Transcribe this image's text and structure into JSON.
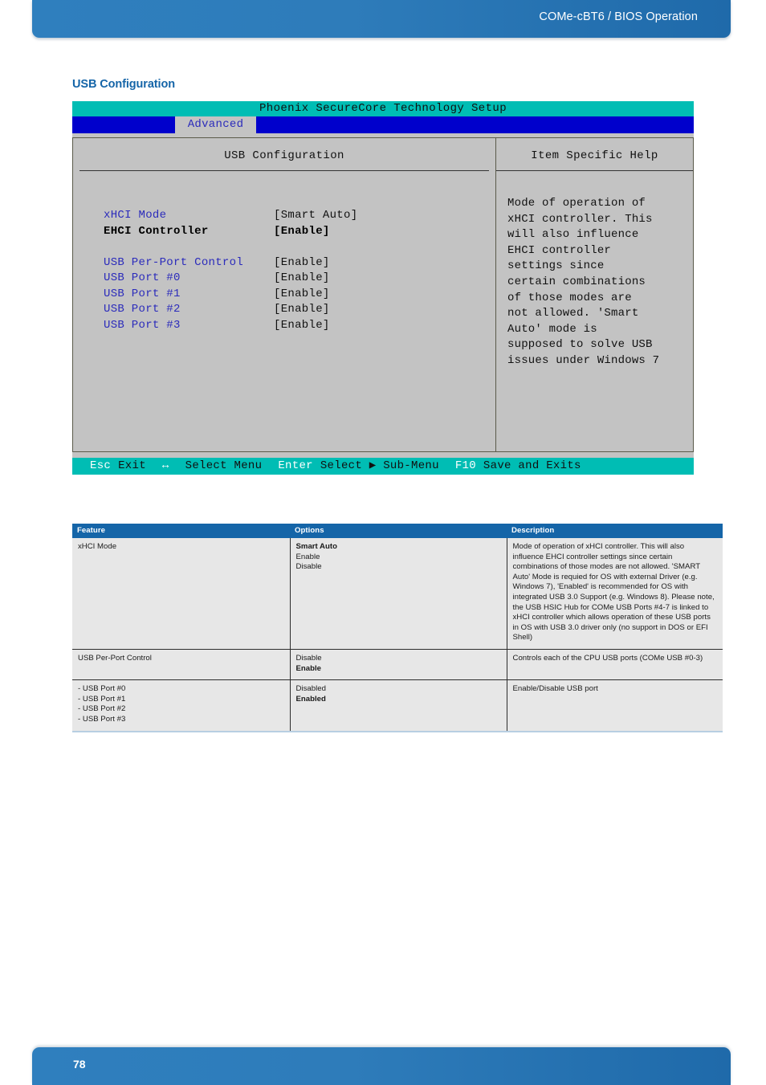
{
  "header": {
    "title": "COMe-cBT6 / BIOS Operation"
  },
  "section": {
    "heading": "USB Configuration"
  },
  "bios": {
    "title": "Phoenix SecureCore Technology Setup",
    "active_tab": "Advanced",
    "left_panel_title": "USB Configuration",
    "right_panel_title": "Item Specific Help",
    "settings": [
      {
        "label": "xHCI Mode",
        "value": "[Smart Auto]",
        "selected": false
      },
      {
        "label": "EHCI Controller",
        "value": "[Enable]",
        "selected": true
      },
      {
        "label": "",
        "value": "",
        "selected": false
      },
      {
        "label": "USB Per-Port Control",
        "value": "[Enable]",
        "selected": false
      },
      {
        "label": "USB Port #0",
        "value": "[Enable]",
        "selected": false
      },
      {
        "label": "USB Port #1",
        "value": "[Enable]",
        "selected": false
      },
      {
        "label": "USB Port #2",
        "value": "[Enable]",
        "selected": false
      },
      {
        "label": "USB Port #3",
        "value": "[Enable]",
        "selected": false
      }
    ],
    "help_text": "Mode of operation of\nxHCI controller. This\nwill also influence\nEHCI controller\nsettings since\ncertain combinations\nof those modes are\nnot allowed. 'Smart\nAuto' mode is\nsupposed to solve USB\nissues under Windows 7",
    "status_keys": [
      {
        "key": "Esc",
        "desc": "Exit"
      },
      {
        "key": "↔",
        "desc": "Select Menu"
      },
      {
        "key": "Enter",
        "desc": "Select ▶ Sub-Menu"
      },
      {
        "key": "F10",
        "desc": "Save and Exits"
      }
    ]
  },
  "table": {
    "headers": [
      "Feature",
      "Options",
      "Description"
    ],
    "rows": [
      {
        "feature": [
          "xHCI Mode"
        ],
        "options": [
          {
            "text": "Smart Auto",
            "bold": true
          },
          {
            "text": "Enable",
            "bold": false
          },
          {
            "text": "Disable",
            "bold": false
          }
        ],
        "description": "Mode of operation of xHCI controller. This will also influence EHCI controller settings since certain combinations of those modes are not allowed. 'SMART Auto' Mode is requied for OS with external Driver (e.g. Windows 7), 'Enabled' is recommended for OS with integrated USB 3.0 Support (e.g. Windows 8). Please note, the USB HSIC Hub for COMe USB Ports #4-7 is linked to xHCI controller which allows operation of these USB ports in OS with USB 3.0 driver only (no support in DOS or EFI Shell)"
      },
      {
        "feature": [
          "USB Per-Port Control"
        ],
        "options": [
          {
            "text": "Disable",
            "bold": false
          },
          {
            "text": "Enable",
            "bold": true
          }
        ],
        "description": "Controls each of the CPU USB ports (COMe USB #0-3)"
      },
      {
        "feature": [
          "- USB Port #0",
          "- USB Port #1",
          "- USB Port #2",
          "- USB Port #3"
        ],
        "options": [
          {
            "text": "Disabled",
            "bold": false
          },
          {
            "text": "Enabled",
            "bold": true
          }
        ],
        "description": "Enable/Disable USB port"
      }
    ]
  },
  "footer": {
    "page_number": "78"
  }
}
